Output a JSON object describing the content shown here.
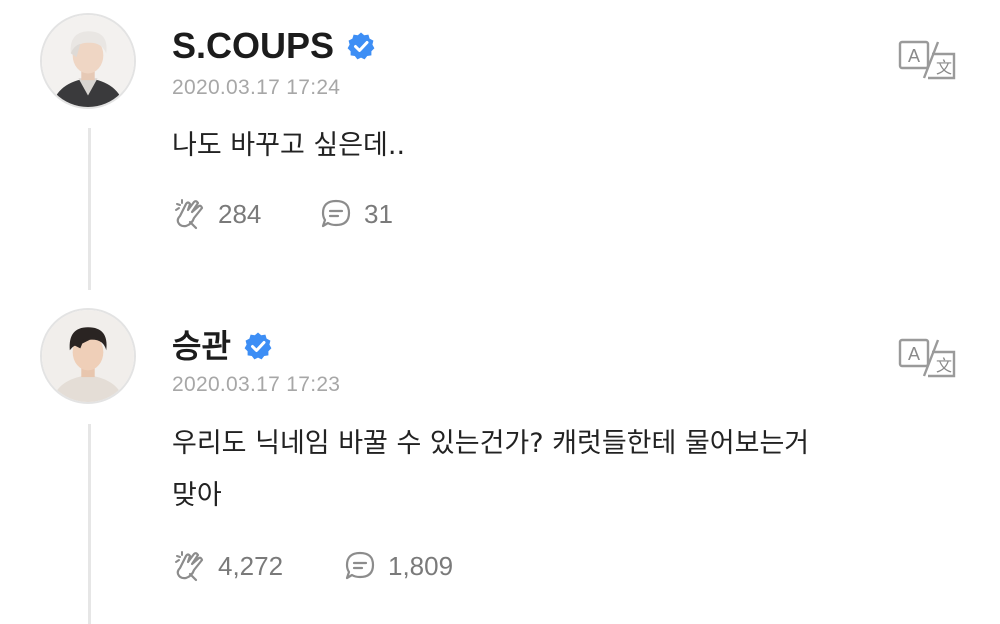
{
  "posts": [
    {
      "author": "S.COUPS",
      "verified": true,
      "timestamp": "2020.03.17 17:24",
      "text": "나도 바꾸고 싶은데..",
      "likes": "284",
      "comments": "31"
    },
    {
      "author": "승관",
      "verified": true,
      "timestamp": "2020.03.17 17:23",
      "text": "우리도 닉네임 바꿀 수 있는건가? 캐럿들한테 물어보는거\n맞아",
      "likes": "4,272",
      "comments": "1,809"
    }
  ],
  "icons": {
    "verified": "verified-badge-icon",
    "translate": "translate-icon",
    "like": "clap-hands-icon",
    "comment": "comment-bubble-icon"
  },
  "colors": {
    "verified_blue": "#3d8ef5",
    "timestamp_gray": "#a7a7a7",
    "action_gray": "#7a7a7a",
    "thread_line": "#e6e6e6"
  }
}
